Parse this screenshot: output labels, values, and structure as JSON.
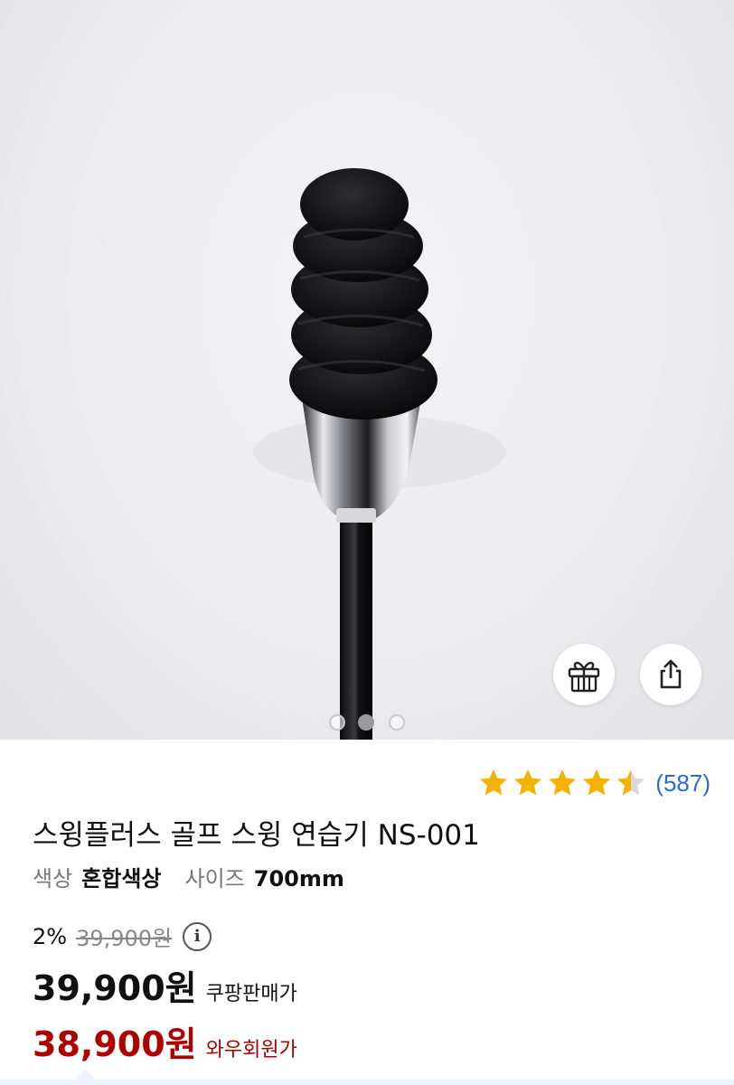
{
  "product": {
    "title": "스윙플러스 골프 스윙 연습기 NS-001",
    "image_alt": "골프 스윙 연습기 그립 이미지",
    "image_index": 2,
    "image_count": 3
  },
  "actions": {
    "gift_icon": "gift-icon",
    "share_icon": "share-icon"
  },
  "rating": {
    "stars": 4.5,
    "max_stars": 5,
    "review_count": "(587)",
    "star_color": "#f5b301",
    "empty_star_color": "#d9d9d9",
    "link_color": "#2a6ad8"
  },
  "options": [
    {
      "key": "색상",
      "value": "혼합색상"
    },
    {
      "key": "사이즈",
      "value": "700mm"
    }
  ],
  "pricing": {
    "discount_rate": "2%",
    "original_price": "39,900원",
    "sale_price": "39,900원",
    "sale_label": "쿠팡판매가",
    "member_price": "38,900원",
    "member_label": "와우회원가",
    "member_color": "#ae0000"
  },
  "info_icon_glyph": "i"
}
